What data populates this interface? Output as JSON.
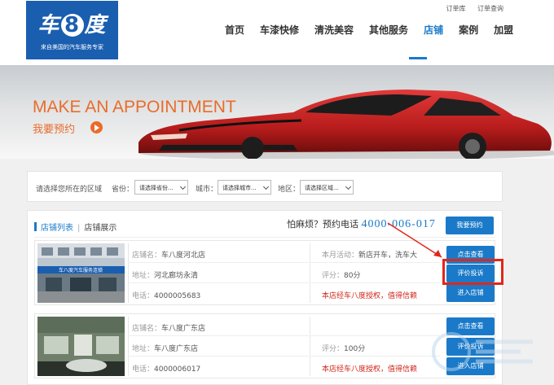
{
  "header": {
    "logo_text_left": "车",
    "logo_text_num": "8",
    "logo_text_right": "度",
    "logo_sub": "来自美国的汽车服务专家",
    "top_links": [
      "订单库",
      "订单查询"
    ],
    "nav": [
      "首页",
      "车漆快修",
      "清洗美容",
      "其他服务",
      "店铺",
      "案例",
      "加盟"
    ]
  },
  "banner": {
    "title": "MAKE AN APPOINTMENT",
    "subtitle": "我要预约"
  },
  "filter": {
    "prompt": "请选择您所在的区域",
    "province_label": "省份：",
    "province_value": "请选择省份...",
    "city_label": "城市：",
    "city_value": "请选择城市...",
    "district_label": "地区：",
    "district_value": "请选择区域..."
  },
  "panel": {
    "tab_list": "店铺列表",
    "tab_show": "店铺展示",
    "hotline_text": "怕麻烦？预约电话",
    "hotline_number": "4000-006-017",
    "book_button": "我要预约"
  },
  "stores": [
    {
      "name_label": "店铺名：",
      "name": "车八度河北店",
      "addr_label": "地址：",
      "addr": "河北廊坊永清",
      "phone_label": "电话：",
      "phone": "4000005683",
      "activity_label": "本月活动：",
      "activity": "新店开车，洗车大",
      "score_label": "评分：",
      "score": "80分",
      "auth": "本店经车八度授权，值得信赖",
      "btn_view": "点击查看",
      "btn_review": "评价投诉",
      "btn_enter": "进入店铺",
      "photo_sign": "车八度汽车服务连锁"
    },
    {
      "name_label": "店铺名：",
      "name": "车八度广东店",
      "addr_label": "地址：",
      "addr": "车八度广东店",
      "phone_label": "电话：",
      "phone": "4000006017",
      "activity_label": "",
      "activity": "",
      "score_label": "评分：",
      "score": "100分",
      "auth": "本店经车八度授权，值得信赖",
      "btn_view": "点击查看",
      "btn_review": "评价投诉",
      "btn_enter": "进入店铺"
    }
  ],
  "colors": {
    "brand_blue": "#1a7ac9",
    "logo_blue": "#1a5eb0",
    "accent_orange": "#e96c2a",
    "warn_red": "#d0261c",
    "highlight_red": "#e2261a"
  }
}
